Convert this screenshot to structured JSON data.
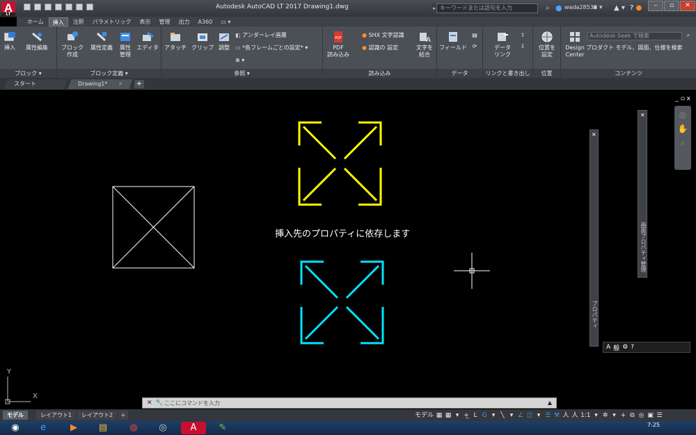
{
  "titlebar": {
    "app_logo": "A",
    "app_logo_sub": "LT",
    "title": "Autodesk AutoCAD LT 2017    Drawing1.dwg",
    "search_placeholder": "キーワードまたは語句を入力",
    "user": "wada28530",
    "time_tray": "7:25"
  },
  "ribbon_tabs": [
    "ホーム",
    "挿入",
    "注釈",
    "パラメトリック",
    "表示",
    "管理",
    "出力",
    "A360",
    "▭ ▾"
  ],
  "ribbon_active_tab": "挿入",
  "ribbon": {
    "block_panel": {
      "title": "ブロック ▾",
      "insert": "挿入",
      "edit_attr": "属性編集"
    },
    "block_def_panel": {
      "title": "ブロック定義 ▾",
      "create": "ブロック\n作成",
      "define_attr": "属性定義",
      "manage_attr": "属性\n管理",
      "editor": "エディタ"
    },
    "reference_panel": {
      "title": "参照 ▾",
      "attach": "アタッチ",
      "clip": "クリップ",
      "adjust": "調整",
      "underlay_layers": "アンダーレイ画層",
      "frame_settings": "*各フレームごとの設定* ▾",
      "snap": "⊕ ▾"
    },
    "import_panel": {
      "title": "読み込み",
      "pdf": "PDF\n読み込み",
      "shx": "SHX 文字認識",
      "recognize_settings": "認識の 設定",
      "combine_text": "文字を\n結合"
    },
    "data_panel": {
      "title": "データ",
      "field": "フィールド"
    },
    "link_panel": {
      "title": "リンクと書き出し",
      "data_link": "データ\nリンク"
    },
    "location_panel": {
      "title": "位置",
      "set_location": "位置を\n設定"
    },
    "content_panel": {
      "title": "コンテンツ",
      "design_center": "Design\nCenter",
      "seek_placeholder": "Autodesk Seek で検索",
      "product_models": "プロダクト モデル、図面、仕様を検索"
    }
  },
  "file_tabs": {
    "start": "スタート",
    "drawing": "Drawing1*",
    "close": "✕",
    "add": "+"
  },
  "canvas": {
    "annotation": "挿入先のプロパティに依存します",
    "viewport_controls": "_ ▫ x",
    "ucs_y": "Y",
    "ucs_x": "X",
    "colors": {
      "white_block": "#ffffff",
      "yellow_block": "#ffff00",
      "cyan_block": "#00e5ff"
    }
  },
  "palettes": {
    "properties_label": "プロパティ",
    "block_label": "画面プロパティ管理",
    "close": "✕"
  },
  "commandline": {
    "placeholder": "ここにコマンドを入力"
  },
  "layout_tabs": [
    "モデル",
    "レイアウト1",
    "レイアウト2",
    "+"
  ],
  "status_tools": [
    "モデル",
    "▦",
    "▦",
    "▾",
    "+̲",
    "L",
    "G",
    "▾",
    "╲",
    "▾",
    "∠",
    "◫",
    "▾",
    "☰",
    "⚒",
    "人",
    "人",
    "1:1",
    "▾",
    "✲",
    "▾",
    "+",
    "⧉",
    "◎",
    "▣",
    "☰"
  ]
}
